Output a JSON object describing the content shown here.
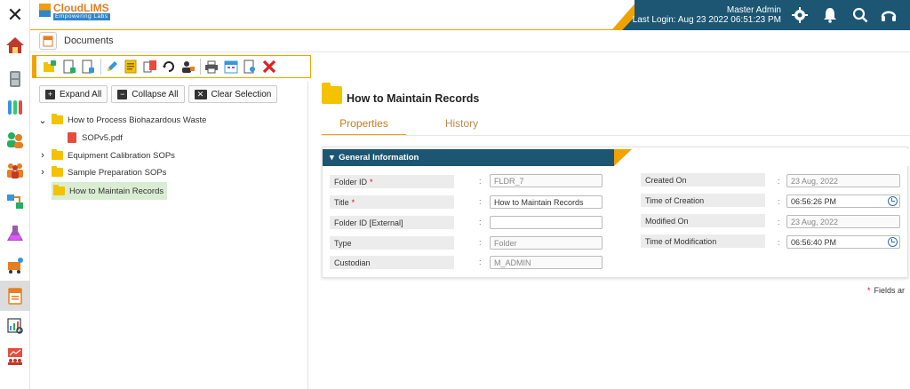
{
  "header": {
    "logo_name": "CloudLIMS",
    "logo_tagline": "Empowering Labs",
    "user_name": "Master Admin",
    "last_login": "Last Login: Aug 23 2022 06:51:23 PM"
  },
  "breadcrumb": {
    "title": "Documents"
  },
  "toolbar": {
    "buttons": [
      "add-folder",
      "add-document",
      "copy-document",
      "edit",
      "properties",
      "move",
      "refresh",
      "assign-user",
      "print",
      "schedule",
      "preview",
      "delete"
    ]
  },
  "tree_panel": {
    "expand_all": "Expand All",
    "collapse_all": "Collapse All",
    "clear_selection": "Clear Selection",
    "nodes": [
      {
        "label": "How to Process Biohazardous Waste",
        "expanded": true
      },
      {
        "label": "SOPv5.pdf"
      },
      {
        "label": "Equipment Calibration SOPs",
        "expanded": false
      },
      {
        "label": "Sample Preparation SOPs",
        "expanded": false
      },
      {
        "label": "How to Maintain Records",
        "selected": true
      }
    ]
  },
  "detail": {
    "title": "How to Maintain Records",
    "tabs": [
      "Properties",
      "History"
    ],
    "section_title": "General Information",
    "fields": {
      "folder_id": {
        "label": "Folder ID",
        "value": "FLDR_7"
      },
      "title": {
        "label": "Title",
        "value": "How to Maintain Records"
      },
      "folder_id_external": {
        "label": "Folder ID [External]",
        "value": ""
      },
      "type": {
        "label": "Type",
        "value": "Folder"
      },
      "custodian": {
        "label": "Custodian",
        "value": "M_ADMIN"
      },
      "created_on": {
        "label": "Created On",
        "value": "23 Aug, 2022"
      },
      "time_of_creation": {
        "label": "Time of Creation",
        "value": "06:56:26 PM"
      },
      "modified_on": {
        "label": "Modified On",
        "value": "23 Aug, 2022"
      },
      "time_of_modification": {
        "label": "Time of Modification",
        "value": "06:56:40 PM"
      }
    },
    "required_note": "Fields ar"
  },
  "colors": {
    "navy": "#1c5673",
    "orange": "#f0a300",
    "selected_row": "#d9edd3"
  }
}
